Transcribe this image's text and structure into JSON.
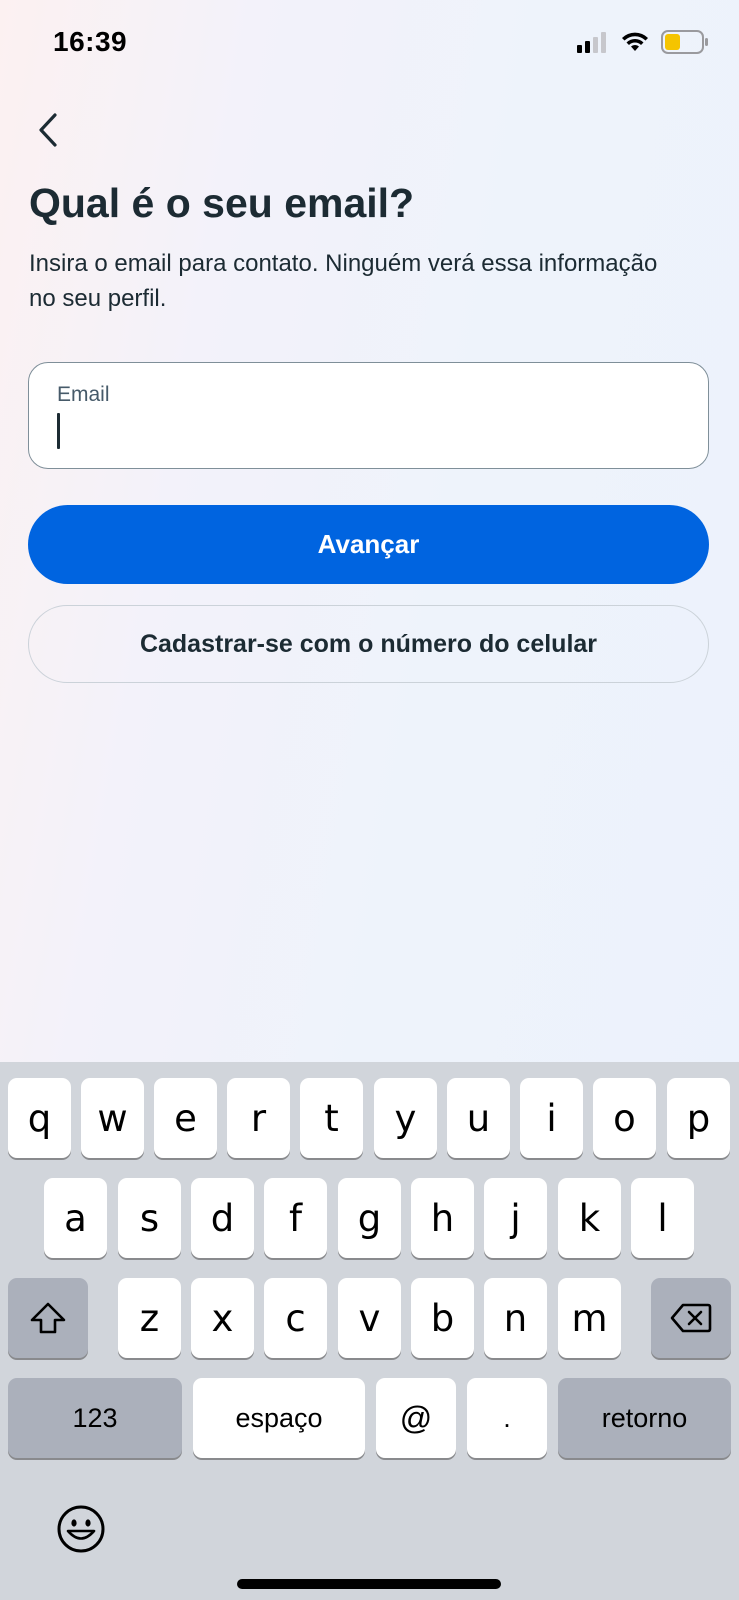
{
  "status_bar": {
    "time": "16:39",
    "icons": [
      "cellular-signal-icon",
      "wifi-icon",
      "battery-icon"
    ],
    "battery_color": "#f5c400"
  },
  "header": {
    "back_icon": "chevron-left-icon",
    "title": "Qual é o seu email?",
    "subtitle": "Insira o email para contato. Ninguém verá essa informação no seu perfil."
  },
  "form": {
    "email_label": "Email",
    "email_value": ""
  },
  "buttons": {
    "next_label": "Avançar",
    "phone_signup_label": "Cadastrar-se com o número do celular"
  },
  "colors": {
    "primary": "#0064e0",
    "text": "#1c2b33"
  },
  "keyboard": {
    "row1": [
      "q",
      "w",
      "e",
      "r",
      "t",
      "y",
      "u",
      "i",
      "o",
      "p"
    ],
    "row2": [
      "a",
      "s",
      "d",
      "f",
      "g",
      "h",
      "j",
      "k",
      "l"
    ],
    "row3": [
      "z",
      "x",
      "c",
      "v",
      "b",
      "n",
      "m"
    ],
    "shift_icon": "shift-icon",
    "delete_icon": "delete-icon",
    "numbers_label": "123",
    "space_label": "espaço",
    "at_label": "@",
    "dot_label": ".",
    "return_label": "retorno",
    "emoji_icon": "emoji-icon"
  }
}
